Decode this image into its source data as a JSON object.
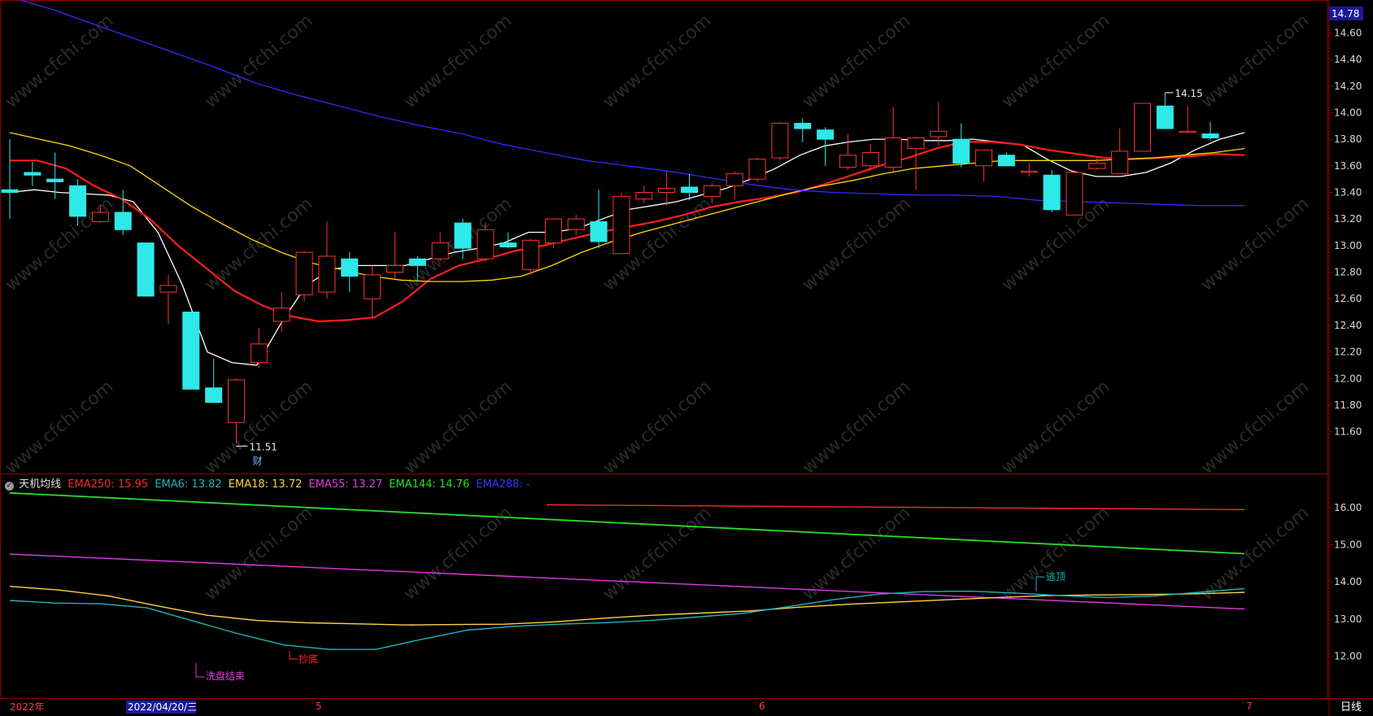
{
  "legend": {
    "indicator_name": "天机均线",
    "items": [
      {
        "label": "EMA250: 15.95",
        "color": "#ff2a2a"
      },
      {
        "label": "EMA6: 13.82",
        "color": "#1fb5b5"
      },
      {
        "label": "EMA18: 13.72",
        "color": "#ffd24a"
      },
      {
        "label": "EMA55: 13.27",
        "color": "#e23ae2"
      },
      {
        "label": "EMA144: 14.76",
        "color": "#26e026"
      },
      {
        "label": "EMA288: -",
        "color": "#2a3aff"
      }
    ]
  },
  "axis": {
    "top_badge": "14.78",
    "date_left": "2022年",
    "date_selected": "2022/04/20/三",
    "month_5": "5",
    "month_6": "6",
    "month_7": "7",
    "period": "日线"
  },
  "annotations": {
    "low": "11.51",
    "low_tag": "财",
    "high": "14.15",
    "bottom": "抄底",
    "washout": "洗盘结束",
    "top": "逃顶"
  },
  "watermark": "www.cfchi.com",
  "chart_data": [
    {
      "type": "candlestick",
      "y_ticks": [
        11.6,
        11.8,
        12.0,
        12.2,
        12.4,
        12.6,
        12.8,
        13.0,
        13.2,
        13.4,
        13.6,
        13.8,
        14.0,
        14.2,
        14.4,
        14.6
      ],
      "ylim": [
        11.4,
        14.78
      ],
      "candles": [
        {
          "o": 13.42,
          "h": 13.8,
          "l": 13.2,
          "c": 13.4
        },
        {
          "o": 13.55,
          "h": 13.63,
          "l": 13.45,
          "c": 13.53
        },
        {
          "o": 13.5,
          "h": 13.7,
          "l": 13.35,
          "c": 13.48
        },
        {
          "o": 13.45,
          "h": 13.5,
          "l": 13.15,
          "c": 13.22
        },
        {
          "o": 13.18,
          "h": 13.3,
          "l": 13.17,
          "c": 13.25
        },
        {
          "o": 13.25,
          "h": 13.42,
          "l": 13.08,
          "c": 13.12
        },
        {
          "o": 13.02,
          "h": 13.02,
          "l": 12.62,
          "c": 12.62
        },
        {
          "o": 12.65,
          "h": 12.78,
          "l": 12.41,
          "c": 12.7
        },
        {
          "o": 12.5,
          "h": 12.5,
          "l": 11.92,
          "c": 11.92
        },
        {
          "o": 11.93,
          "h": 12.15,
          "l": 11.82,
          "c": 11.82
        },
        {
          "o": 11.67,
          "h": 12.0,
          "l": 11.51,
          "c": 11.99
        },
        {
          "o": 12.12,
          "h": 12.38,
          "l": 12.08,
          "c": 12.26
        },
        {
          "o": 12.43,
          "h": 12.65,
          "l": 12.35,
          "c": 12.53
        },
        {
          "o": 12.63,
          "h": 12.96,
          "l": 12.58,
          "c": 12.95
        },
        {
          "o": 12.65,
          "h": 13.18,
          "l": 12.6,
          "c": 12.92
        },
        {
          "o": 12.9,
          "h": 12.95,
          "l": 12.65,
          "c": 12.77
        },
        {
          "o": 12.6,
          "h": 12.85,
          "l": 12.45,
          "c": 12.78
        },
        {
          "o": 12.8,
          "h": 13.1,
          "l": 12.75,
          "c": 12.85
        },
        {
          "o": 12.9,
          "h": 12.92,
          "l": 12.73,
          "c": 12.85
        },
        {
          "o": 12.9,
          "h": 13.1,
          "l": 12.88,
          "c": 13.02
        },
        {
          "o": 13.17,
          "h": 13.2,
          "l": 12.9,
          "c": 12.98
        },
        {
          "o": 12.9,
          "h": 13.17,
          "l": 12.88,
          "c": 13.12
        },
        {
          "o": 13.02,
          "h": 13.1,
          "l": 12.98,
          "c": 12.99
        },
        {
          "o": 12.82,
          "h": 13.05,
          "l": 12.78,
          "c": 13.04
        },
        {
          "o": 13.02,
          "h": 13.2,
          "l": 12.98,
          "c": 13.2
        },
        {
          "o": 13.12,
          "h": 13.23,
          "l": 13.08,
          "c": 13.2
        },
        {
          "o": 13.18,
          "h": 13.42,
          "l": 12.98,
          "c": 13.03
        },
        {
          "o": 12.94,
          "h": 13.4,
          "l": 12.94,
          "c": 13.37
        },
        {
          "o": 13.35,
          "h": 13.45,
          "l": 13.32,
          "c": 13.4
        },
        {
          "o": 13.4,
          "h": 13.56,
          "l": 13.3,
          "c": 13.43
        },
        {
          "o": 13.44,
          "h": 13.54,
          "l": 13.34,
          "c": 13.4
        },
        {
          "o": 13.37,
          "h": 13.47,
          "l": 13.32,
          "c": 13.45
        },
        {
          "o": 13.45,
          "h": 13.56,
          "l": 13.35,
          "c": 13.54
        },
        {
          "o": 13.5,
          "h": 13.66,
          "l": 13.48,
          "c": 13.65
        },
        {
          "o": 13.66,
          "h": 13.93,
          "l": 13.64,
          "c": 13.92
        },
        {
          "o": 13.92,
          "h": 13.96,
          "l": 13.78,
          "c": 13.88
        },
        {
          "o": 13.87,
          "h": 13.89,
          "l": 13.6,
          "c": 13.8
        },
        {
          "o": 13.59,
          "h": 13.84,
          "l": 13.57,
          "c": 13.68
        },
        {
          "o": 13.6,
          "h": 13.76,
          "l": 13.56,
          "c": 13.7
        },
        {
          "o": 13.59,
          "h": 14.04,
          "l": 13.56,
          "c": 13.81
        },
        {
          "o": 13.73,
          "h": 13.82,
          "l": 13.42,
          "c": 13.81
        },
        {
          "o": 13.82,
          "h": 14.08,
          "l": 13.75,
          "c": 13.86
        },
        {
          "o": 13.8,
          "h": 13.92,
          "l": 13.59,
          "c": 13.62
        },
        {
          "o": 13.6,
          "h": 13.72,
          "l": 13.48,
          "c": 13.72
        },
        {
          "o": 13.68,
          "h": 13.7,
          "l": 13.6,
          "c": 13.6
        },
        {
          "o": 13.56,
          "h": 13.62,
          "l": 13.52,
          "c": 13.56
        },
        {
          "o": 13.53,
          "h": 13.57,
          "l": 13.25,
          "c": 13.27
        },
        {
          "o": 13.23,
          "h": 13.57,
          "l": 13.23,
          "c": 13.55
        },
        {
          "o": 13.58,
          "h": 13.66,
          "l": 13.57,
          "c": 13.62
        },
        {
          "o": 13.54,
          "h": 13.88,
          "l": 13.54,
          "c": 13.71
        },
        {
          "o": 13.71,
          "h": 14.07,
          "l": 13.71,
          "c": 14.07
        },
        {
          "o": 14.05,
          "h": 14.15,
          "l": 13.88,
          "c": 13.88
        },
        {
          "o": 13.86,
          "h": 14.05,
          "l": 13.86,
          "c": 13.86
        },
        {
          "o": 13.84,
          "h": 13.93,
          "l": 13.79,
          "c": 13.81
        }
      ],
      "overlays": [
        {
          "color": "#ffffff",
          "values": [
            13.4,
            13.42,
            13.4,
            13.39,
            13.38,
            13.33,
            13.1,
            12.7,
            12.2,
            12.12,
            12.1,
            12.42,
            12.7,
            12.82,
            12.85,
            12.85,
            12.85,
            12.9,
            12.95,
            12.98,
            13.02,
            13.1,
            13.1,
            13.13,
            13.2,
            13.27,
            13.3,
            13.33,
            13.38,
            13.43,
            13.5,
            13.58,
            13.68,
            13.75,
            13.78,
            13.8,
            13.8,
            13.79,
            13.79,
            13.8,
            13.78,
            13.76,
            13.65,
            13.56,
            13.52,
            13.52,
            13.55,
            13.62,
            13.72,
            13.8,
            13.85
          ]
        },
        {
          "color": "#ff1e1e",
          "values": [
            13.64,
            13.64,
            13.58,
            13.45,
            13.35,
            13.2,
            13.0,
            12.83,
            12.66,
            12.55,
            12.47,
            12.43,
            12.44,
            12.46,
            12.58,
            12.75,
            12.85,
            12.9,
            12.96,
            13.0,
            13.05,
            13.1,
            13.14,
            13.18,
            13.23,
            13.29,
            13.33,
            13.36,
            13.4,
            13.46,
            13.53,
            13.6,
            13.66,
            13.73,
            13.78,
            13.78,
            13.76,
            13.72,
            13.69,
            13.66,
            13.65,
            13.66,
            13.67,
            13.69,
            13.68
          ]
        },
        {
          "color": "#ffd700",
          "values": [
            13.85,
            13.8,
            13.75,
            13.68,
            13.6,
            13.45,
            13.3,
            13.17,
            13.05,
            12.95,
            12.87,
            12.82,
            12.77,
            12.74,
            12.73,
            12.73,
            12.74,
            12.77,
            12.85,
            12.95,
            13.03,
            13.1,
            13.16,
            13.22,
            13.28,
            13.34,
            13.4,
            13.45,
            13.49,
            13.54,
            13.58,
            13.6,
            13.62,
            13.64,
            13.64,
            13.64,
            13.64,
            13.65,
            13.66,
            13.68,
            13.7,
            13.73
          ]
        },
        {
          "color": "#2c2cff",
          "values": [
            14.87,
            14.78,
            14.67,
            14.56,
            14.45,
            14.34,
            14.22,
            14.13,
            14.05,
            13.97,
            13.9,
            13.84,
            13.76,
            13.7,
            13.64,
            13.6,
            13.56,
            13.51,
            13.46,
            13.42,
            13.4,
            13.39,
            13.38,
            13.38,
            13.37,
            13.34,
            13.33,
            13.32,
            13.31,
            13.3,
            13.3
          ]
        }
      ]
    },
    {
      "type": "line",
      "y_ticks": [
        12.0,
        13.0,
        14.0,
        15.0,
        16.0
      ],
      "ylim": [
        11.45,
        16.6
      ],
      "series": [
        {
          "name": "EMA250",
          "color": "#ff2a2a",
          "x": [
            672,
            1530
          ],
          "values": [
            16.08,
            15.95
          ]
        },
        {
          "name": "EMA144",
          "color": "#26e026",
          "x": [
            12,
            1530
          ],
          "values": [
            16.4,
            14.76
          ]
        },
        {
          "name": "EMA55",
          "color": "#e23ae2",
          "x": [
            12,
            1530
          ],
          "values": [
            14.75,
            13.27
          ]
        },
        {
          "name": "EMA18",
          "color": "#ffd24a",
          "values": [
            13.88,
            13.78,
            13.62,
            13.35,
            13.1,
            12.96,
            12.9,
            12.87,
            12.84,
            12.85,
            12.86,
            12.92,
            13.02,
            13.1,
            13.16,
            13.22,
            13.32,
            13.4,
            13.46,
            13.52,
            13.58,
            13.63,
            13.65,
            13.66,
            13.68,
            13.72
          ]
        },
        {
          "name": "EMA6",
          "color": "#1fb5b5",
          "values": [
            13.5,
            13.43,
            13.41,
            13.3,
            12.95,
            12.6,
            12.3,
            12.18,
            12.18,
            12.45,
            12.7,
            12.8,
            12.86,
            12.9,
            12.96,
            13.05,
            13.15,
            13.33,
            13.52,
            13.67,
            13.74,
            13.75,
            13.7,
            13.63,
            13.58,
            13.62,
            13.72,
            13.82
          ]
        }
      ]
    }
  ]
}
